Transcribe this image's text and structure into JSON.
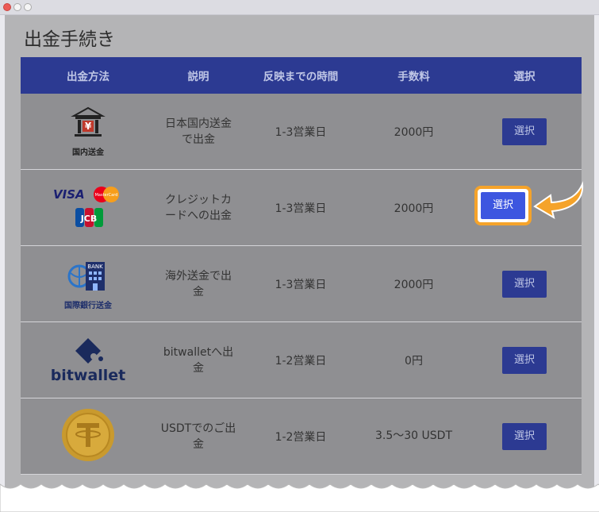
{
  "page": {
    "title": "出金手続き"
  },
  "table": {
    "headers": [
      "出金方法",
      "説明",
      "反映までの時間",
      "手数料",
      "選択"
    ],
    "rows": [
      {
        "method_label": "国内送金",
        "desc": "日本国内送金で出金",
        "time": "1-3営業日",
        "fee": "2000円",
        "button": "選択"
      },
      {
        "method_label": "VISA",
        "desc": "クレジットカードへの出金",
        "time": "1-3営業日",
        "fee": "2000円",
        "button": "選択"
      },
      {
        "method_label": "国際銀行送金",
        "desc": "海外送金で出金",
        "time": "1-3営業日",
        "fee": "2000円",
        "button": "選択"
      },
      {
        "method_label": "bitwallet",
        "desc": "bitwalletへ出金",
        "time": "1-2営業日",
        "fee": "0円",
        "button": "選択"
      },
      {
        "method_label": "USDT",
        "desc": "USDTでのご出金",
        "time": "1-2営業日",
        "fee": "3.5〜30 USDT",
        "button": "選択"
      }
    ]
  },
  "logos": {
    "mastercard": "MasterCard",
    "jcb": "JCB",
    "bank": "BANK",
    "yen": "¥"
  },
  "highlight": {
    "row": 1,
    "color": "#f5a32a"
  },
  "colors": {
    "header_bg": "#2c3a92",
    "button_bg": "#3d56e0",
    "accent": "#f5a32a"
  }
}
